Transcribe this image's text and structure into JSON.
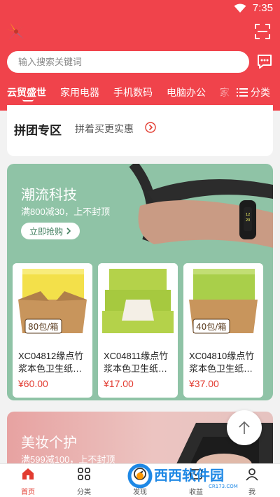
{
  "status_bar": {
    "time": "7:35"
  },
  "search": {
    "placeholder": "输入搜索关键词"
  },
  "tabs": [
    {
      "label": "云贸盛世",
      "active": true
    },
    {
      "label": "家用电器"
    },
    {
      "label": "手机数码"
    },
    {
      "label": "电脑办公"
    },
    {
      "label": "家"
    }
  ],
  "category_button": {
    "label": "分类"
  },
  "group_buy": {
    "title": "拼团专区",
    "subtitle": "拼着买更实惠"
  },
  "promo_tech": {
    "title": "潮流科技",
    "subtitle": "满800减30，上不封顶",
    "button": "立即抢购",
    "products": [
      {
        "name": "XC04812缘点竹浆本色卫生纸…",
        "price": "¥60.00",
        "pack_label": "80包/箱"
      },
      {
        "name": "XC04811缘点竹浆本色卫生纸…",
        "price": "¥17.00",
        "pack_label": ""
      },
      {
        "name": "XC04810缘点竹浆本色卫生纸…",
        "price": "¥37.00",
        "pack_label": "40包/箱"
      }
    ]
  },
  "promo_beauty": {
    "title": "美妆个护",
    "subtitle": "满599减100，上不封顶"
  },
  "tabbar": [
    {
      "label": "首页",
      "icon": "home-icon",
      "active": true
    },
    {
      "label": "分类",
      "icon": "grid-icon"
    },
    {
      "label": "发现",
      "icon": "discover-icon"
    },
    {
      "label": "收益",
      "icon": "income-icon"
    },
    {
      "label": "我",
      "icon": "user-icon"
    }
  ],
  "watermark": {
    "text": "西西软件园",
    "url_text": "CR173.COM"
  },
  "colors": {
    "primary": "#f0434b",
    "price": "#e23b30",
    "tech_bg": "#8fc3a6",
    "beauty_bg": "#e7a2a1"
  }
}
